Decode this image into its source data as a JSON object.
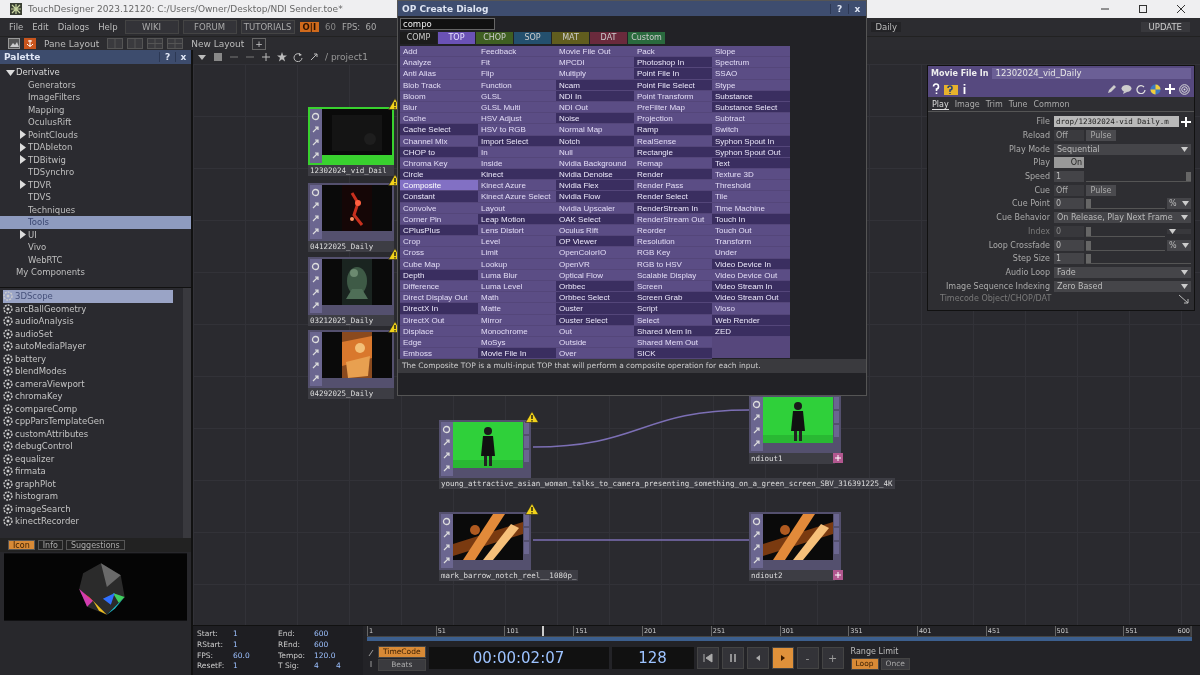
{
  "window": {
    "title": "TouchDesigner 2023.12120: C:/Users/Owner/Desktop/NDI Sender.toe*"
  },
  "menu": [
    "File",
    "Edit",
    "Dialogs",
    "Help"
  ],
  "links": [
    "WIKI",
    "FORUM",
    "TUTORIALS"
  ],
  "perform_button": "O|I",
  "fps_target": "60",
  "fps": "FPS:  60",
  "pane_name": "Daily",
  "update_button": "UPDATE",
  "layout_bar": {
    "pane_layout": "Pane Layout",
    "new_layout": "New Layout",
    "add": "+"
  },
  "palette": {
    "title": "Palette",
    "help": "?",
    "close": "x",
    "tree": [
      {
        "label": "Derivative",
        "expandable": true,
        "expanded": true,
        "selected": false,
        "children": [
          {
            "label": "Generators",
            "expandable": false,
            "expanded": false,
            "selected": false
          },
          {
            "label": "ImageFilters",
            "expandable": false,
            "expanded": false,
            "selected": false
          },
          {
            "label": "Mapping",
            "expandable": false,
            "expanded": false,
            "selected": false
          },
          {
            "label": "OculusRift",
            "expandable": false,
            "expanded": false,
            "selected": false
          },
          {
            "label": "PointClouds",
            "expandable": true,
            "expanded": false,
            "selected": false
          },
          {
            "label": "TDAbleton",
            "expandable": true,
            "expanded": false,
            "selected": false
          },
          {
            "label": "TDBitwig",
            "expandable": true,
            "expanded": false,
            "selected": false
          },
          {
            "label": "TDSynchro",
            "expandable": false,
            "expanded": false,
            "selected": false
          },
          {
            "label": "TDVR",
            "expandable": true,
            "expanded": false,
            "selected": false
          },
          {
            "label": "TDVS",
            "expandable": false,
            "expanded": false,
            "selected": false
          },
          {
            "label": "Techniques",
            "expandable": false,
            "expanded": false,
            "selected": false
          },
          {
            "label": "Tools",
            "expandable": false,
            "expanded": false,
            "selected": true
          },
          {
            "label": "UI",
            "expandable": true,
            "expanded": false,
            "selected": false
          },
          {
            "label": "Vivo",
            "expandable": false,
            "expanded": false,
            "selected": false
          },
          {
            "label": "WebRTC",
            "expandable": false,
            "expanded": false,
            "selected": false
          }
        ]
      },
      {
        "label": "My Components",
        "expandable": false,
        "expanded": false,
        "selected": false
      }
    ],
    "items": [
      {
        "label": "3DScope",
        "selected": true
      },
      {
        "label": "arcBallGeometry",
        "selected": false
      },
      {
        "label": "audioAnalysis",
        "selected": false
      },
      {
        "label": "audioSet",
        "selected": false
      },
      {
        "label": "autoMediaPlayer",
        "selected": false
      },
      {
        "label": "battery",
        "selected": false
      },
      {
        "label": "blendModes",
        "selected": false
      },
      {
        "label": "cameraViewport",
        "selected": false
      },
      {
        "label": "chromaKey",
        "selected": false
      },
      {
        "label": "compareComp",
        "selected": false
      },
      {
        "label": "cppParsTemplateGen",
        "selected": false
      },
      {
        "label": "customAttributes",
        "selected": false
      },
      {
        "label": "debugControl",
        "selected": false
      },
      {
        "label": "equalizer",
        "selected": false
      },
      {
        "label": "firmata",
        "selected": false
      },
      {
        "label": "graphPlot",
        "selected": false
      },
      {
        "label": "histogram",
        "selected": false
      },
      {
        "label": "imageSearch",
        "selected": false
      },
      {
        "label": "kinectRecorder",
        "selected": false
      }
    ],
    "tabs": [
      {
        "label": "Icon",
        "selected": true
      },
      {
        "label": "Info",
        "selected": false
      },
      {
        "label": "Suggestions",
        "selected": false
      }
    ]
  },
  "network": {
    "path": "/ project1",
    "nodes": [
      {
        "name": "12302024_vid_Dail",
        "kind": "movie",
        "selected": true,
        "warning": true
      },
      {
        "name": "04122025_Daily",
        "kind": "movie",
        "selected": false,
        "warning": true
      },
      {
        "name": "03212025_Daily",
        "kind": "movie",
        "selected": false,
        "warning": true
      },
      {
        "name": "04292025_Daily",
        "kind": "movie",
        "selected": false,
        "warning": true
      },
      {
        "name": "young_attractive_asian_woman_talks_to_camera_presenting_something_on_a_green_screen_SBV_316391225_4K",
        "kind": "movie",
        "selected": false,
        "warning": true
      },
      {
        "name": "ndiout1",
        "kind": "ndi",
        "selected": false,
        "warning": false
      },
      {
        "name": "mark_barrow_notch_reel__1080p_",
        "kind": "movie",
        "selected": false,
        "warning": true
      },
      {
        "name": "ndiout2",
        "kind": "ndi",
        "selected": false,
        "warning": false
      }
    ]
  },
  "dialog": {
    "title": "OP Create Dialog",
    "help": "?",
    "close": "x",
    "search": "compo",
    "families": [
      {
        "label": "COMP",
        "color": "#1c1c1c",
        "selected": false
      },
      {
        "label": "TOP",
        "color": "#6a52b5",
        "selected": true
      },
      {
        "label": "CHOP",
        "color": "#3f5f22",
        "selected": false
      },
      {
        "label": "SOP",
        "color": "#24506e",
        "selected": false
      },
      {
        "label": "MAT",
        "color": "#615d1e",
        "selected": false
      },
      {
        "label": "DAT",
        "color": "#6a2a3c",
        "selected": false
      },
      {
        "label": "Custom",
        "color": "#2a6a3e",
        "selected": false
      }
    ],
    "columns": [
      [
        {
          "label": "Add",
          "shaded": false,
          "selected": false
        },
        {
          "label": "Analyze",
          "shaded": false,
          "selected": false
        },
        {
          "label": "Anti Alias",
          "shaded": false,
          "selected": false
        },
        {
          "label": "Blob Track",
          "shaded": false,
          "selected": false
        },
        {
          "label": "Bloom",
          "shaded": false,
          "selected": false
        },
        {
          "label": "Blur",
          "shaded": false,
          "selected": false
        },
        {
          "label": "Cache",
          "shaded": false,
          "selected": false
        },
        {
          "label": "Cache Select",
          "shaded": true,
          "selected": false
        },
        {
          "label": "Channel Mix",
          "shaded": false,
          "selected": false
        },
        {
          "label": "CHOP to",
          "shaded": true,
          "selected": false
        },
        {
          "label": "Chroma Key",
          "shaded": false,
          "selected": false
        },
        {
          "label": "Circle",
          "shaded": true,
          "selected": false
        },
        {
          "label": "Composite",
          "shaded": false,
          "selected": true
        },
        {
          "label": "Constant",
          "shaded": true,
          "selected": false
        },
        {
          "label": "Convolve",
          "shaded": false,
          "selected": false
        },
        {
          "label": "Corner Pin",
          "shaded": false,
          "selected": false
        },
        {
          "label": "CPlusPlus",
          "shaded": true,
          "selected": false
        },
        {
          "label": "Crop",
          "shaded": false,
          "selected": false
        },
        {
          "label": "Cross",
          "shaded": false,
          "selected": false
        },
        {
          "label": "Cube Map",
          "shaded": false,
          "selected": false
        },
        {
          "label": "Depth",
          "shaded": true,
          "selected": false
        },
        {
          "label": "Difference",
          "shaded": false,
          "selected": false
        },
        {
          "label": "Direct Display Out",
          "shaded": false,
          "selected": false
        },
        {
          "label": "DirectX In",
          "shaded": true,
          "selected": false
        },
        {
          "label": "DirectX Out",
          "shaded": false,
          "selected": false
        },
        {
          "label": "Displace",
          "shaded": false,
          "selected": false
        },
        {
          "label": "Edge",
          "shaded": false,
          "selected": false
        },
        {
          "label": "Emboss",
          "shaded": false,
          "selected": false
        }
      ],
      [
        {
          "label": "Feedback",
          "shaded": false,
          "selected": false
        },
        {
          "label": "Fit",
          "shaded": false,
          "selected": false
        },
        {
          "label": "Flip",
          "shaded": false,
          "selected": false
        },
        {
          "label": "Function",
          "shaded": false,
          "selected": false
        },
        {
          "label": "GLSL",
          "shaded": false,
          "selected": false
        },
        {
          "label": "GLSL Multi",
          "shaded": false,
          "selected": false
        },
        {
          "label": "HSV Adjust",
          "shaded": false,
          "selected": false
        },
        {
          "label": "HSV to RGB",
          "shaded": false,
          "selected": false
        },
        {
          "label": "Import Select",
          "shaded": true,
          "selected": false
        },
        {
          "label": "In",
          "shaded": false,
          "selected": false
        },
        {
          "label": "Inside",
          "shaded": false,
          "selected": false
        },
        {
          "label": "Kinect",
          "shaded": true,
          "selected": false
        },
        {
          "label": "Kinect Azure",
          "shaded": false,
          "selected": false
        },
        {
          "label": "Kinect Azure Select",
          "shaded": false,
          "selected": false
        },
        {
          "label": "Layout",
          "shaded": false,
          "selected": false
        },
        {
          "label": "Leap Motion",
          "shaded": true,
          "selected": false
        },
        {
          "label": "Lens Distort",
          "shaded": false,
          "selected": false
        },
        {
          "label": "Level",
          "shaded": false,
          "selected": false
        },
        {
          "label": "Limit",
          "shaded": false,
          "selected": false
        },
        {
          "label": "Lookup",
          "shaded": false,
          "selected": false
        },
        {
          "label": "Luma Blur",
          "shaded": false,
          "selected": false
        },
        {
          "label": "Luma Level",
          "shaded": false,
          "selected": false
        },
        {
          "label": "Math",
          "shaded": false,
          "selected": false
        },
        {
          "label": "Matte",
          "shaded": false,
          "selected": false
        },
        {
          "label": "Mirror",
          "shaded": false,
          "selected": false
        },
        {
          "label": "Monochrome",
          "shaded": false,
          "selected": false
        },
        {
          "label": "MoSys",
          "shaded": false,
          "selected": false
        },
        {
          "label": "Movie File In",
          "shaded": true,
          "selected": false
        }
      ],
      [
        {
          "label": "Movie File Out",
          "shaded": false,
          "selected": false
        },
        {
          "label": "MPCDI",
          "shaded": false,
          "selected": false
        },
        {
          "label": "Multiply",
          "shaded": false,
          "selected": false
        },
        {
          "label": "Ncam",
          "shaded": true,
          "selected": false
        },
        {
          "label": "NDI In",
          "shaded": true,
          "selected": false
        },
        {
          "label": "NDI Out",
          "shaded": false,
          "selected": false
        },
        {
          "label": "Noise",
          "shaded": true,
          "selected": false
        },
        {
          "label": "Normal Map",
          "shaded": false,
          "selected": false
        },
        {
          "label": "Notch",
          "shaded": true,
          "selected": false
        },
        {
          "label": "Null",
          "shaded": false,
          "selected": false
        },
        {
          "label": "Nvidia Background",
          "shaded": false,
          "selected": false
        },
        {
          "label": "Nvidia Denoise",
          "shaded": true,
          "selected": false
        },
        {
          "label": "Nvidia Flex",
          "shaded": true,
          "selected": false
        },
        {
          "label": "Nvidia Flow",
          "shaded": true,
          "selected": false
        },
        {
          "label": "Nvidia Upscaler",
          "shaded": false,
          "selected": false
        },
        {
          "label": "OAK Select",
          "shaded": true,
          "selected": false
        },
        {
          "label": "Oculus Rift",
          "shaded": false,
          "selected": false
        },
        {
          "label": "OP Viewer",
          "shaded": true,
          "selected": false
        },
        {
          "label": "OpenColorIO",
          "shaded": false,
          "selected": false
        },
        {
          "label": "OpenVR",
          "shaded": false,
          "selected": false
        },
        {
          "label": "Optical Flow",
          "shaded": false,
          "selected": false
        },
        {
          "label": "Orbbec",
          "shaded": true,
          "selected": false
        },
        {
          "label": "Orbbec Select",
          "shaded": true,
          "selected": false
        },
        {
          "label": "Ouster",
          "shaded": true,
          "selected": false
        },
        {
          "label": "Ouster Select",
          "shaded": true,
          "selected": false
        },
        {
          "label": "Out",
          "shaded": false,
          "selected": false
        },
        {
          "label": "Outside",
          "shaded": false,
          "selected": false
        },
        {
          "label": "Over",
          "shaded": false,
          "selected": false
        }
      ],
      [
        {
          "label": "Pack",
          "shaded": false,
          "selected": false
        },
        {
          "label": "Photoshop In",
          "shaded": true,
          "selected": false
        },
        {
          "label": "Point File In",
          "shaded": true,
          "selected": false
        },
        {
          "label": "Point File Select",
          "shaded": true,
          "selected": false
        },
        {
          "label": "Point Transform",
          "shaded": false,
          "selected": false
        },
        {
          "label": "PreFilter Map",
          "shaded": false,
          "selected": false
        },
        {
          "label": "Projection",
          "shaded": false,
          "selected": false
        },
        {
          "label": "Ramp",
          "shaded": true,
          "selected": false
        },
        {
          "label": "RealSense",
          "shaded": false,
          "selected": false
        },
        {
          "label": "Rectangle",
          "shaded": true,
          "selected": false
        },
        {
          "label": "Remap",
          "shaded": false,
          "selected": false
        },
        {
          "label": "Render",
          "shaded": true,
          "selected": false
        },
        {
          "label": "Render Pass",
          "shaded": false,
          "selected": false
        },
        {
          "label": "Render Select",
          "shaded": true,
          "selected": false
        },
        {
          "label": "RenderStream In",
          "shaded": true,
          "selected": false
        },
        {
          "label": "RenderStream Out",
          "shaded": false,
          "selected": false
        },
        {
          "label": "Reorder",
          "shaded": false,
          "selected": false
        },
        {
          "label": "Resolution",
          "shaded": false,
          "selected": false
        },
        {
          "label": "RGB Key",
          "shaded": false,
          "selected": false
        },
        {
          "label": "RGB to HSV",
          "shaded": false,
          "selected": false
        },
        {
          "label": "Scalable Display",
          "shaded": false,
          "selected": false
        },
        {
          "label": "Screen",
          "shaded": false,
          "selected": false
        },
        {
          "label": "Screen Grab",
          "shaded": true,
          "selected": false
        },
        {
          "label": "Script",
          "shaded": true,
          "selected": false
        },
        {
          "label": "Select",
          "shaded": false,
          "selected": false
        },
        {
          "label": "Shared Mem In",
          "shaded": true,
          "selected": false
        },
        {
          "label": "Shared Mem Out",
          "shaded": false,
          "selected": false
        },
        {
          "label": "SICK",
          "shaded": true,
          "selected": false
        }
      ],
      [
        {
          "label": "Slope",
          "shaded": false,
          "selected": false
        },
        {
          "label": "Spectrum",
          "shaded": false,
          "selected": false
        },
        {
          "label": "SSAO",
          "shaded": false,
          "selected": false
        },
        {
          "label": "Stype",
          "shaded": false,
          "selected": false
        },
        {
          "label": "Substance",
          "shaded": true,
          "selected": false
        },
        {
          "label": "Substance Select",
          "shaded": true,
          "selected": false
        },
        {
          "label": "Subtract",
          "shaded": false,
          "selected": false
        },
        {
          "label": "Switch",
          "shaded": false,
          "selected": false
        },
        {
          "label": "Syphon Spout In",
          "shaded": true,
          "selected": false
        },
        {
          "label": "Syphon Spout Out",
          "shaded": true,
          "selected": false
        },
        {
          "label": "Text",
          "shaded": true,
          "selected": false
        },
        {
          "label": "Texture 3D",
          "shaded": false,
          "selected": false
        },
        {
          "label": "Threshold",
          "shaded": false,
          "selected": false
        },
        {
          "label": "Tile",
          "shaded": false,
          "selected": false
        },
        {
          "label": "Time Machine",
          "shaded": false,
          "selected": false
        },
        {
          "label": "Touch In",
          "shaded": true,
          "selected": false
        },
        {
          "label": "Touch Out",
          "shaded": false,
          "selected": false
        },
        {
          "label": "Transform",
          "shaded": false,
          "selected": false
        },
        {
          "label": "Under",
          "shaded": false,
          "selected": false
        },
        {
          "label": "Video Device In",
          "shaded": true,
          "selected": false
        },
        {
          "label": "Video Device Out",
          "shaded": false,
          "selected": false
        },
        {
          "label": "Video Stream In",
          "shaded": true,
          "selected": false
        },
        {
          "label": "Video Stream Out",
          "shaded": true,
          "selected": false
        },
        {
          "label": "Vioso",
          "shaded": false,
          "selected": false
        },
        {
          "label": "Web Render",
          "shaded": true,
          "selected": false
        },
        {
          "label": "ZED",
          "shaded": true,
          "selected": false
        }
      ]
    ],
    "description": "The Composite TOP is a multi-input TOP that will perform a composite operation for each input."
  },
  "parameters": {
    "type": "Movie File In",
    "name": "12302024_vid_Daily",
    "tabs": [
      {
        "label": "Play",
        "selected": true
      },
      {
        "label": "Image",
        "selected": false
      },
      {
        "label": "Trim",
        "selected": false
      },
      {
        "label": "Tune",
        "selected": false
      },
      {
        "label": "Common",
        "selected": false
      }
    ],
    "params": [
      {
        "kind": "field",
        "label": "File",
        "value": "drop/12302024-vid Daily.m",
        "disabled": false
      },
      {
        "kind": "toggle",
        "label": "Reload",
        "text": "Off",
        "on": false,
        "button": "Pulse",
        "disabled": false
      },
      {
        "kind": "menu",
        "label": "Play Mode",
        "value": "Sequential",
        "disabled": false
      },
      {
        "kind": "toggle",
        "label": "Play",
        "text": "On",
        "on": true,
        "disabled": false
      },
      {
        "kind": "number",
        "label": "Speed",
        "value": "1",
        "level": 1,
        "unit_menu": false,
        "disabled": false
      },
      {
        "kind": "toggle",
        "label": "Cue",
        "text": "Off",
        "on": false,
        "button": "Pulse",
        "disabled": false
      },
      {
        "kind": "number",
        "label": "Cue Point",
        "value": "0",
        "level": 0,
        "unit_menu": true,
        "unit": "%",
        "disabled": false
      },
      {
        "kind": "menu",
        "label": "Cue Behavior",
        "value": "On Release, Play Next Frame",
        "disabled": false
      },
      {
        "kind": "number",
        "label": "Index",
        "value": "0",
        "level": 0,
        "unit_menu": true,
        "disabled": true
      },
      {
        "kind": "number",
        "label": "Loop Crossfade",
        "value": "0",
        "level": 0,
        "unit_menu": true,
        "unit": "%",
        "disabled": false
      },
      {
        "kind": "number",
        "label": "Step Size",
        "value": "1",
        "level": 0,
        "unit_menu": false,
        "disabled": false
      },
      {
        "kind": "menu",
        "label": "Audio Loop",
        "value": "Fade",
        "disabled": false
      },
      {
        "kind": "menu",
        "label": "Image Sequence Indexing",
        "value": "Zero Based",
        "disabled": false
      }
    ],
    "footer": "Timecode Object/CHOP/DAT"
  },
  "timeline": {
    "info": [
      {
        "label": "Start:",
        "value": "1"
      },
      {
        "label": "End:",
        "value": "600"
      },
      {
        "label": "RStart:",
        "value": "1"
      },
      {
        "label": "REnd:",
        "value": "600"
      },
      {
        "label": "FPS:",
        "value": "60.0"
      },
      {
        "label": "Tempo:",
        "value": "120.0"
      },
      {
        "label": "ResetF:",
        "value": "1"
      },
      {
        "label": "T Sig:",
        "value": "4",
        "value_2": "4"
      }
    ],
    "ticks": [
      "1",
      "51",
      "101",
      "151",
      "201",
      "251",
      "301",
      "351",
      "401",
      "451",
      "501",
      "551",
      "600"
    ],
    "playhead": {
      "level": 0.212
    },
    "modes": [
      {
        "label": "TimeCode",
        "selected": true
      },
      {
        "label": "Beats",
        "selected": false
      }
    ],
    "timecode": "00:00:02:07",
    "frame": "128",
    "transport": [
      {
        "kind": "rewind",
        "active": false
      },
      {
        "kind": "pause",
        "active": false
      },
      {
        "kind": "back",
        "active": false
      },
      {
        "kind": "play",
        "active": true
      },
      {
        "kind": "minus",
        "text": "-",
        "active": false
      },
      {
        "kind": "plus",
        "text": "+",
        "active": false
      }
    ],
    "range_label": "Range Limit",
    "range": [
      {
        "label": "Loop",
        "selected": true
      },
      {
        "label": "Once",
        "selected": false
      }
    ]
  }
}
